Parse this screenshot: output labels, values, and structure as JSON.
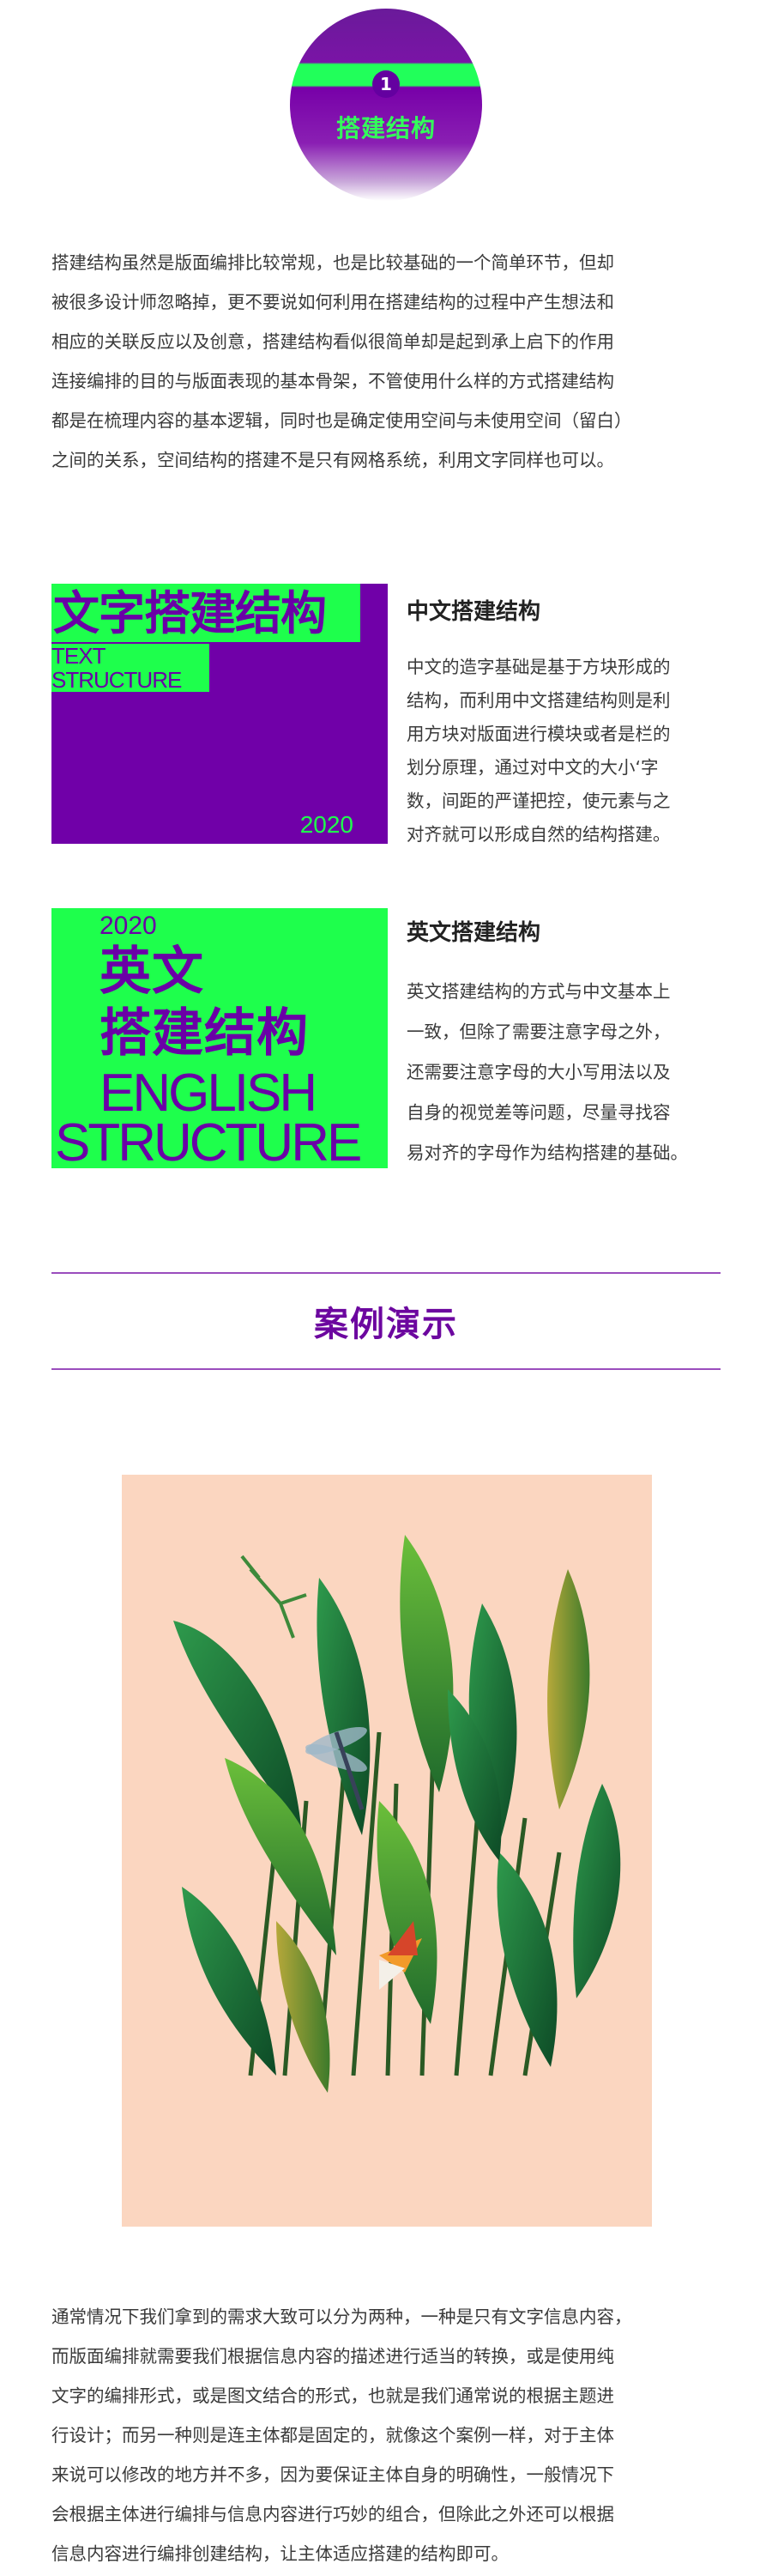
{
  "header": {
    "number": "1",
    "title": "搭建结构"
  },
  "intro_lines": [
    "搭建结构虽然是版面编排比较常规，也是比较基础的一个简单环节，但却",
    "被很多设计师忽略掉，更不要说如何利用在搭建结构的过程中产生想法和",
    "相应的关联反应以及创意，搭建结构看似很简单却是起到承上启下的作用",
    "连接编排的目的与版面表现的基本骨架，不管使用什么样的方式搭建结构",
    "都是在梳理内容的基本逻辑，同时也是确定使用空间与未使用空间（留白）",
    "之间的关系，空间结构的搭建不是只有网格系统，利用文字同样也可以。"
  ],
  "block_cn": {
    "card": {
      "title": "文字搭建结构",
      "en_line1": "TEXT",
      "en_line2": "STRUCTURE",
      "year": "2020"
    },
    "heading": "中文搭建结构",
    "lines": [
      "中文的造字基础是基于方块形成的",
      "结构，而利用中文搭建结构则是利",
      "用方块对版面进行模块或者是栏的",
      "划分原理，通过对中文的大小‘字",
      "数，间距的严谨把控，使元素与之",
      "对齐就可以形成自然的结构搭建。"
    ]
  },
  "block_en": {
    "card": {
      "year": "2020",
      "cn_line1": "英文",
      "cn_line2": "搭建结构",
      "en_line1": "ENGLISH",
      "en_line2": "STRUCTURE"
    },
    "heading": "英文搭建结构",
    "lines": [
      "英文搭建结构的方式与中文基本上",
      "一致，但除了需要注意字母之外，",
      "还需要注意字母的大小写用法以及",
      "自身的视觉差等问题，尽量寻找容",
      "易对齐的字母作为结构搭建的基础。"
    ]
  },
  "section_title": "案例演示",
  "outro_lines": [
    "通常情况下我们拿到的需求大致可以分为两种，一种是只有文字信息内容，",
    "而版面编排就需要我们根据信息内容的描述进行适当的转换，或是使用纯",
    "文字的编排形式，或是图文结合的形式，也就是我们通常说的根据主题进",
    "行设计；而另一种则是连主体都是固定的，就像这个案例一样，对于主体",
    "来说可以修改的地方并不多，因为要保证主体自身的明确性，一般情况下",
    "会根据主体进行编排与信息内容进行巧妙的组合，但除此之外还可以根据",
    "信息内容进行编排创建结构，让主体适应搭建的结构即可。"
  ],
  "colors": {
    "purple": "#7000a8",
    "green": "#1eff4c",
    "poster_bg": "#fbd6c0"
  }
}
